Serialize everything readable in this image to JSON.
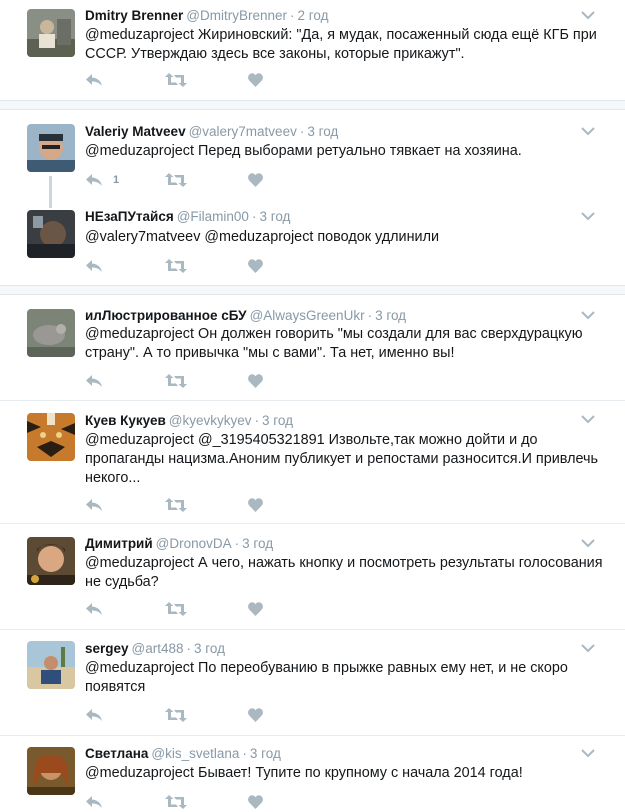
{
  "tweets": [
    {
      "name": "Dmitry Brenner",
      "handle": "@DmitryBrenner",
      "time": "2 год",
      "text": "@meduzaproject Жириновский: \"Да, я мудак, посаженный сюда ещё КГБ при СССР. Утверждаю здесь все законы, которые прикажут\".",
      "reply_count": ""
    },
    {
      "name": "Valeriy Matveev",
      "handle": "@valery7matveev",
      "time": "3 год",
      "text": "@meduzaproject Перед выборами ретуально тявкает на хозяина.",
      "reply_count": "1"
    },
    {
      "name": "НЕзаПУтайся",
      "handle": "@Filamin00",
      "time": "3 год",
      "text": "@valery7matveev @meduzaproject поводок удлинили",
      "reply_count": ""
    },
    {
      "name": "илЛюстрированное сБУ",
      "handle": "@AlwaysGreenUkr",
      "time": "3 год",
      "text": "@meduzaproject Он должен говорить \"мы создали для вас сверхдурацкую страну\". А то привычка \"мы с вами\". Та нет, именно вы!",
      "reply_count": ""
    },
    {
      "name": "Куев Кукуев",
      "handle": "@kyevkykyev",
      "time": "3 год",
      "text": "@meduzaproject @_3195405321891 Извольте,так можно дойти и до пропаганды нацизма.Аноним публикует и репостами разносится.И привлечь некого...",
      "reply_count": ""
    },
    {
      "name": "Димитрий",
      "handle": "@DronovDA",
      "time": "3 год",
      "text": "@meduzaproject А чего, нажать кнопку и посмотреть результаты голосования не судьба?",
      "reply_count": ""
    },
    {
      "name": "sergey",
      "handle": "@art488",
      "time": "3 год",
      "text": "@meduzaproject По переобуванию в прыжке равных ему нет, и не скоро появятся",
      "reply_count": ""
    },
    {
      "name": "Светлана",
      "handle": "@kis_svetlana",
      "time": "3 год",
      "text": "@meduzaproject Бывает! Тупите по крупному с начала 2014 года!",
      "reply_count": ""
    }
  ],
  "colors": {
    "icon": "#aab8c2",
    "name": "#14171a",
    "meta": "#8899a6"
  },
  "icons": [
    "reply-icon",
    "retweet-icon",
    "like-icon",
    "caret-down-icon"
  ]
}
